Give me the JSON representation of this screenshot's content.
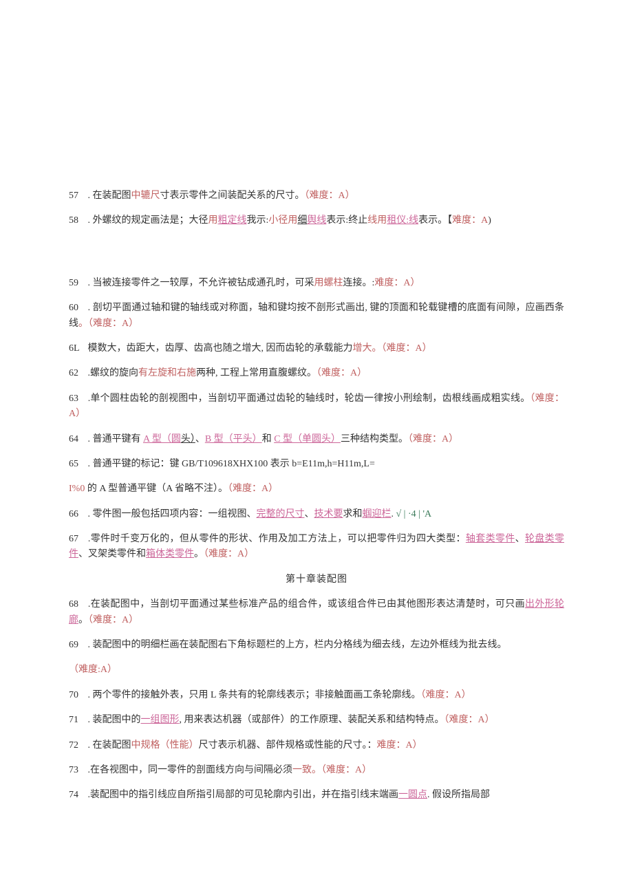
{
  "items": [
    {
      "num": "57",
      "parts": [
        {
          "t": " . 在装配图",
          "cls": ""
        },
        {
          "t": "中辘尺",
          "cls": "red"
        },
        {
          "t": "寸表示零件之间装配关系的尺寸。",
          "cls": ""
        },
        {
          "t": "（难度：A）",
          "cls": "red"
        }
      ]
    },
    {
      "num": "58",
      "parts": [
        {
          "t": " . 外螺纹的规定画法是；大径",
          "cls": ""
        },
        {
          "t": "用",
          "cls": "red"
        },
        {
          "t": "粗定线",
          "cls": "redlink"
        },
        {
          "t": "我示:",
          "cls": ""
        },
        {
          "t": "小径用",
          "cls": "red"
        },
        {
          "t": "细",
          "cls": "plain-under"
        },
        {
          "t": "舆线",
          "cls": "redlink"
        },
        {
          "t": "表示:终止",
          "cls": ""
        },
        {
          "t": "线用",
          "cls": "red"
        },
        {
          "t": "租仪:线",
          "cls": "redlink"
        },
        {
          "t": "表示。【",
          "cls": ""
        },
        {
          "t": "难度：A",
          "cls": "red"
        },
        {
          "t": ")",
          "cls": ""
        }
      ]
    },
    {
      "spacer": true
    },
    {
      "num": "59",
      "parts": [
        {
          "t": " . 当被连接零件之一较厚，不允许被钻成通孔时，可采",
          "cls": ""
        },
        {
          "t": "用螺柱",
          "cls": "red"
        },
        {
          "t": "连接。:",
          "cls": ""
        },
        {
          "t": "难度：A）",
          "cls": "red"
        }
      ]
    },
    {
      "num": "60",
      "parts": [
        {
          "t": " . 剖切平面通过轴和键的轴线或对称面，轴和键均按不剖形式画出, 键的顶面和轮载键槽的底面有间隙，应画西条线",
          "cls": ""
        },
        {
          "t": "。（难度：A）",
          "cls": "red"
        }
      ]
    },
    {
      "num": "6L",
      "parts": [
        {
          "t": " 模数大，齿距大，齿厚、齿高也随之增大, 因而齿轮的承载能力",
          "cls": ""
        },
        {
          "t": "增大。（难度：A）",
          "cls": "red"
        }
      ]
    },
    {
      "num": "62",
      "parts": [
        {
          "t": " .螺纹的旋向",
          "cls": ""
        },
        {
          "t": "有左旋和右施",
          "cls": "red"
        },
        {
          "t": "两种, 工程上常用直腹螺纹。",
          "cls": ""
        },
        {
          "t": "（难度：A）",
          "cls": "red"
        }
      ]
    },
    {
      "num": "63",
      "parts": [
        {
          "t": " .单个圆柱齿轮的剖视图中，当剖切平面通过齿轮的轴线时，轮齿一律按小刑绘制，齿根线画成粗实线。",
          "cls": ""
        },
        {
          "t": "（难度：A）",
          "cls": "red"
        }
      ]
    },
    {
      "num": "64",
      "parts": [
        {
          "t": " . 普通平键有 ",
          "cls": ""
        },
        {
          "t": "A 型（圆",
          "cls": "redlink"
        },
        {
          "t": "头）",
          "cls": "plain-under"
        },
        {
          "t": "、",
          "cls": ""
        },
        {
          "t": "B 型（平头）",
          "cls": "redlink"
        },
        {
          "t": "和 ",
          "cls": ""
        },
        {
          "t": "C 型（单圆头）",
          "cls": "redlink"
        },
        {
          "t": "三种结构类型。",
          "cls": ""
        },
        {
          "t": "（难度：A）",
          "cls": "red"
        }
      ]
    },
    {
      "num": "65",
      "parts": [
        {
          "t": " . 普通平键的标记：键 GB/T109618XHX100 表示 b=E11m,h=H11m,L=",
          "cls": ""
        }
      ]
    },
    {
      "num": "",
      "parts": [
        {
          "t": "I%0",
          "cls": "red"
        },
        {
          "t": " 的 A 型普通平键（A 省略不注）。",
          "cls": ""
        },
        {
          "t": "（难度：A）",
          "cls": "red"
        }
      ]
    },
    {
      "num": "66",
      "parts": [
        {
          "t": " . 零件图一般包括四项内容：一组视图、",
          "cls": ""
        },
        {
          "t": "完整的尺寸",
          "cls": "redlink"
        },
        {
          "t": "、",
          "cls": ""
        },
        {
          "t": "技术要",
          "cls": "redlink"
        },
        {
          "t": "求和",
          "cls": ""
        },
        {
          "t": "蝈迎栏",
          "cls": "redlink"
        },
        {
          "t": ". ",
          "cls": ""
        },
        {
          "t": "√ | ·4 | 'A",
          "cls": "greenlink"
        }
      ]
    },
    {
      "num": "67",
      "parts": [
        {
          "t": " .零件时千变万化的，但从零件的形状、作用及加工方法上，可以把零件归为四大类型：",
          "cls": ""
        },
        {
          "t": "轴套类零件",
          "cls": "redlink"
        },
        {
          "t": "、",
          "cls": ""
        },
        {
          "t": "轮盘类零件",
          "cls": "redlink"
        },
        {
          "t": "、叉架类零件和",
          "cls": ""
        },
        {
          "t": "箱体类零件",
          "cls": "redlink"
        },
        {
          "t": "。",
          "cls": ""
        },
        {
          "t": "（难度：A）",
          "cls": "red"
        }
      ]
    },
    {
      "heading": "第十章装配图"
    },
    {
      "num": "68",
      "parts": [
        {
          "t": " .在装配图中，当剖切平面通过某些标准产品的组合件，或该组合件已由其他图形表达清楚时，可只画",
          "cls": ""
        },
        {
          "t": "出外形轮廊",
          "cls": "redlink"
        },
        {
          "t": "。",
          "cls": ""
        },
        {
          "t": "（难度：A）",
          "cls": "red"
        }
      ]
    },
    {
      "num": "69",
      "parts": [
        {
          "t": " . 装配图中的明细栏画在装配图右下角标题栏的上方，栏内分格线为细去线，左边外框线为批去线。",
          "cls": ""
        }
      ]
    },
    {
      "num": "",
      "parts": [
        {
          "t": "（难度:A）",
          "cls": "red"
        }
      ]
    },
    {
      "num": "70",
      "parts": [
        {
          "t": " . 两个零件的接触外表，只用 L 条共有的轮廓线表示；非接触面画工条轮廓线。",
          "cls": ""
        },
        {
          "t": "（难度：A）",
          "cls": "red"
        }
      ]
    },
    {
      "num": "71",
      "parts": [
        {
          "t": " . 装配图中的",
          "cls": ""
        },
        {
          "t": "一组图形",
          "cls": "redlink"
        },
        {
          "t": ", 用来表达机器（或部件）的工作原理、装配关系和结构特点。",
          "cls": ""
        },
        {
          "t": "（难度：A）",
          "cls": "red"
        }
      ]
    },
    {
      "num": "72",
      "parts": [
        {
          "t": " . 在装配图",
          "cls": ""
        },
        {
          "t": "中规格（性能）",
          "cls": "red"
        },
        {
          "t": "尺寸表示机器、部件规格或性能的尺寸。：",
          "cls": ""
        },
        {
          "t": "难度：A）",
          "cls": "red"
        }
      ]
    },
    {
      "num": "73",
      "parts": [
        {
          "t": " .在各视图中，同一零件的剖面线方向与间隔必须",
          "cls": ""
        },
        {
          "t": "一致。（难度：A）",
          "cls": "red"
        }
      ]
    },
    {
      "num": "74",
      "parts": [
        {
          "t": " .装配图中的指引线应自所指引局部的可见轮廓内引出，并在指引线末端画",
          "cls": ""
        },
        {
          "t": "一圆点",
          "cls": "redlink"
        },
        {
          "t": ". 假设所指局部",
          "cls": ""
        }
      ]
    }
  ]
}
